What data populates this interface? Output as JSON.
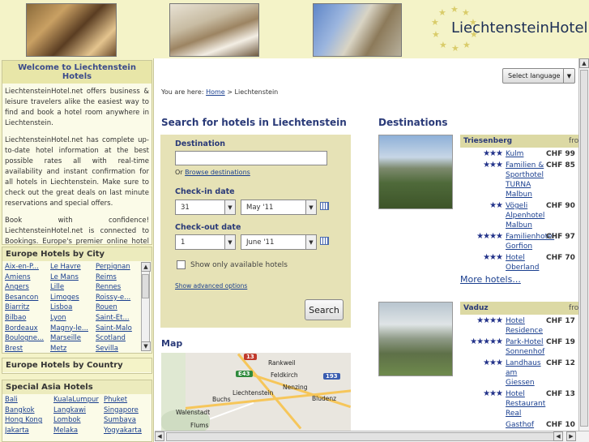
{
  "header": {
    "logo_text": "LiechtensteinHotel.n",
    "photos": [
      "hotel-lobby-photo-icon",
      "hotel-room-photo-icon",
      "castle-statue-photo-icon"
    ]
  },
  "sidebar": {
    "welcome_title": "Welcome to Liechtenstein Hotels",
    "welcome_p1": "LiechtensteinHotel.net offers business & leisure travelers alike the easiest way to find and book a hotel room anywhere in Liechtenstein.",
    "welcome_p2": "LiechtensteinHotel.net has complete up-to-date hotel information at the best possible rates all with real-time availability and instant confirmation for all hotels in Liechtenstein. Make sure to check out the great deals on last minute reservations and special offers.",
    "welcome_p3": "Book with confidence! LiechtensteinHotel.net is connected to Bookings. Europe's premier online hotel reservation company.",
    "europe_city_title": "Europe Hotels by City",
    "europe_cities": [
      "Aix-en-P...",
      "Le Havre",
      "Perpignan",
      "Amiens",
      "Le Mans",
      "Reims",
      "Angers",
      "Lille",
      "Rennes",
      "Besancon",
      "Limoges",
      "Roissy-e...",
      "Biarritz",
      "Lisboa",
      "Rouen",
      "Bilbao",
      "Lyon",
      "Saint-Et...",
      "Bordeaux",
      "Magny-le...",
      "Saint-Malo",
      "Boulogne...",
      "Marseille",
      "Scotland",
      "Brest",
      "Metz",
      "Sevilla"
    ],
    "europe_country_title": "Europe Hotels by Country",
    "asia_title": "Special Asia Hotels",
    "asia_cities": [
      "Bali",
      "KualaLumpur",
      "Phuket",
      "Bangkok",
      "Langkawi",
      "Singapore",
      "Hong Kong",
      "Lombok",
      "Sumbaya",
      "Jakarta",
      "Melaka",
      "Yogyakarta"
    ]
  },
  "main": {
    "language_label": "Select language",
    "breadcrumb_prefix": "You are here:",
    "breadcrumb_home": "Home",
    "breadcrumb_sep": ">",
    "breadcrumb_current": "Liechtenstein",
    "search_title": "Search for hotels in Liechtenstein",
    "destination_label": "Destination",
    "destination_value": "",
    "or_text": "Or",
    "browse_link": "Browse destinations",
    "checkin_label": "Check-in date",
    "checkin_day": "31",
    "checkin_month": "May '11",
    "checkout_label": "Check-out date",
    "checkout_day": "1",
    "checkout_month": "June '11",
    "available_label": "Show only available hotels",
    "advanced_link": "Show advanced options",
    "search_button": "Search",
    "map_title": "Map",
    "map_labels": [
      "Rankweil",
      "Feldkirch",
      "Nenzing",
      "Liechtenstein",
      "Buchs",
      "Bludenz",
      "Walenstadt",
      "Flums"
    ],
    "map_shields": [
      "13",
      "E43",
      "193"
    ],
    "destinations_title": "Destinations",
    "dest1": {
      "city": "Triesenberg",
      "from": "from",
      "hotels": [
        {
          "stars": "★★★",
          "name": "Kulm",
          "price": "CHF 99"
        },
        {
          "stars": "★★★",
          "name": "Familien & Sporthotel TURNA Malbun",
          "price": "CHF 85"
        },
        {
          "stars": "★★",
          "name": "Vögeli Alpenhotel Malbun",
          "price": "CHF 90"
        },
        {
          "stars": "★★★★",
          "name": "Familienhotel Gorfion",
          "price": "CHF 97"
        },
        {
          "stars": "★★★",
          "name": "Hotel Oberland",
          "price": "CHF 70"
        }
      ],
      "more": "More hotels..."
    },
    "dest2": {
      "city": "Vaduz",
      "from": "from",
      "hotels": [
        {
          "stars": "★★★★",
          "name": "Hotel Residence",
          "price": "CHF 17"
        },
        {
          "stars": "★★★★★",
          "name": "Park-Hotel Sonnenhof",
          "price": "CHF 19"
        },
        {
          "stars": "★★★",
          "name": "Landhaus am Giessen",
          "price": "CHF 12"
        },
        {
          "stars": "★★★",
          "name": "Hotel Restaurant Real",
          "price": "CHF 13"
        },
        {
          "stars": "",
          "name": "Gasthof",
          "price": "CHF 10"
        }
      ]
    }
  },
  "colors": {
    "header_bg": "#f4f3c8",
    "title_blue": "#2a3a78",
    "link_blue": "#1a3f8f",
    "star_blue": "#23338a"
  }
}
